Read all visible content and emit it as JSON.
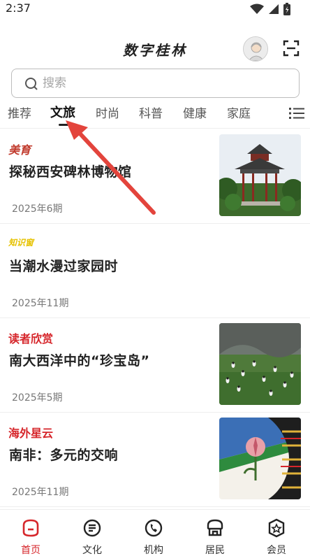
{
  "status_bar": {
    "time": "2:37"
  },
  "header": {
    "title": "数字桂林"
  },
  "search": {
    "placeholder": "搜索"
  },
  "tabs": [
    {
      "label": "推荐"
    },
    {
      "label": "文旅",
      "active": true
    },
    {
      "label": "时尚"
    },
    {
      "label": "科普"
    },
    {
      "label": "健康"
    },
    {
      "label": "家庭"
    }
  ],
  "articles": [
    {
      "tag": "美育",
      "tag_color": "#c0392b",
      "title": "探秘西安碑林博物馆",
      "issue": "2025年6期",
      "thumb": "pavilion-photo"
    },
    {
      "tag": "知识窗",
      "tag_color": "#e6c200",
      "title": "当潮水漫过家园时",
      "issue": "2025年11期"
    },
    {
      "tag": "读者欣赏",
      "tag_color": "#d6262b",
      "title": "南大西洋中的“珍宝岛”",
      "issue": "2025年5期",
      "thumb": "penguin-island-photo"
    },
    {
      "tag": "海外星云",
      "tag_color": "#d6262b",
      "title": "南非：多元的交响",
      "issue": "2025年11期",
      "thumb": "south-africa-illustration"
    }
  ],
  "bottom_nav": [
    {
      "label": "首页",
      "active": true
    },
    {
      "label": "文化"
    },
    {
      "label": "机构"
    },
    {
      "label": "居民"
    },
    {
      "label": "会员"
    }
  ],
  "colors": {
    "accent": "#d6262b",
    "arrow": "#e3443c"
  }
}
